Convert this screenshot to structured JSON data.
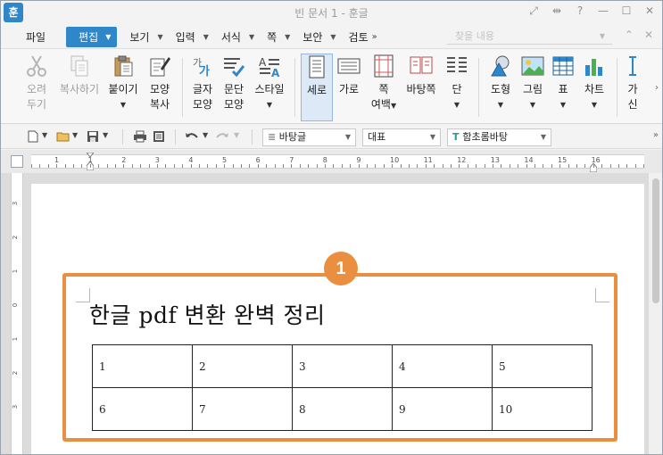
{
  "window": {
    "app_icon_text": "훈",
    "title": "빈 문서 1 - 훈글"
  },
  "menu": {
    "file": "파일",
    "items": [
      {
        "label": "편집",
        "active": true
      },
      {
        "label": "보기"
      },
      {
        "label": "입력"
      },
      {
        "label": "서식"
      },
      {
        "label": "쪽"
      },
      {
        "label": "보안"
      },
      {
        "label": "검토"
      }
    ],
    "more": "»",
    "search_placeholder": "찾을 내용"
  },
  "ribbon": {
    "cut": [
      "오려",
      "두기"
    ],
    "copy": "복사하기",
    "paste": "붙이기",
    "format_copy": [
      "모양",
      "복사"
    ],
    "char_shape": [
      "글자",
      "모양"
    ],
    "para_shape": [
      "문단",
      "모양"
    ],
    "style": "스타일",
    "portrait": "세로",
    "landscape": "가로",
    "page_margin": [
      "쪽",
      "여백"
    ],
    "background_page": "바탕쪽",
    "columns": "단",
    "shape": "도형",
    "picture": "그림",
    "table": "표",
    "chart": "차트",
    "cut_off": [
      "가",
      "신"
    ]
  },
  "toolbar": {
    "style_value": "바탕글",
    "outline_value": "대표",
    "font_value": "함초롬바탕"
  },
  "ruler": {
    "numbers": [
      "1",
      "1",
      "2",
      "3",
      "4",
      "5",
      "6",
      "7",
      "8",
      "9",
      "10",
      "11",
      "12",
      "13",
      "14",
      "15",
      "16"
    ],
    "vnumbers": [
      "3",
      "2",
      "1",
      "0",
      "1",
      "2",
      "3"
    ]
  },
  "document": {
    "title": "한글 pdf 변환 완벽 정리",
    "table": [
      [
        "1",
        "2",
        "3",
        "4",
        "5"
      ],
      [
        "6",
        "7",
        "8",
        "9",
        "10"
      ]
    ]
  },
  "annotation": {
    "badge": "1",
    "color": "#ea8e3f"
  },
  "colors": {
    "accent": "#2f86c8",
    "annotation": "#ea8e3f"
  }
}
